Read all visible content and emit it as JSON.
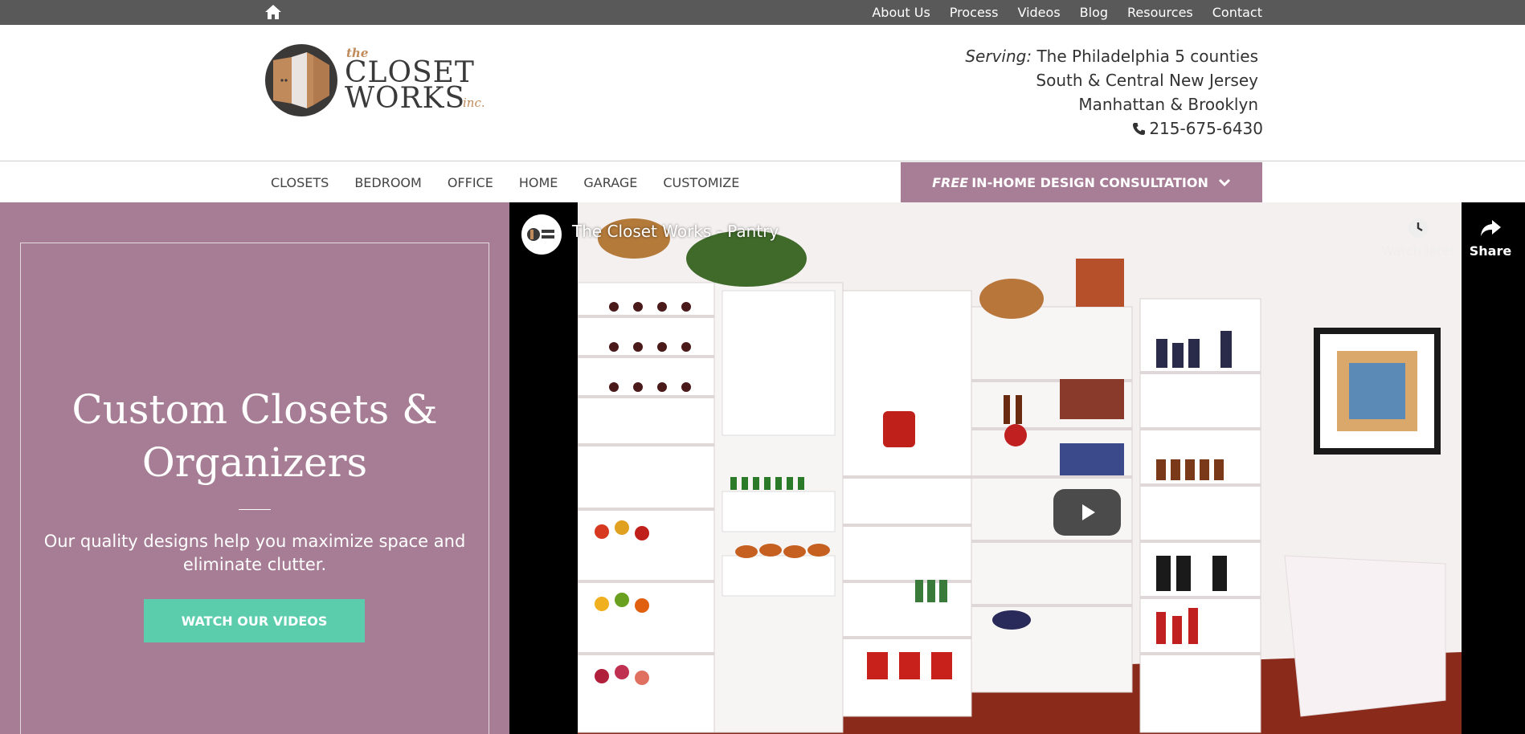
{
  "topbar": {
    "home_icon": "home-icon",
    "links": [
      "About Us",
      "Process",
      "Videos",
      "Blog",
      "Resources",
      "Contact"
    ]
  },
  "header": {
    "logo": {
      "the": "the",
      "closet": "CLOSET",
      "works": "WORKS",
      "inc": "inc."
    },
    "serving_label": "Serving:",
    "serving_line1": "The Philadelphia 5 counties",
    "serving_line2": "South & Central New Jersey",
    "serving_line3": "Manhattan & Brooklyn",
    "phone": "215-675-6430",
    "phone_icon": "phone-icon"
  },
  "nav": {
    "items": [
      "CLOSETS",
      "BEDROOM",
      "OFFICE",
      "HOME",
      "GARAGE",
      "CUSTOMIZE"
    ],
    "consult_free": "FREE",
    "consult_text": "IN-HOME DESIGN CONSULTATION",
    "consult_icon": "chevron-down-icon"
  },
  "hero": {
    "title_line1": "Custom Closets &",
    "title_line2": "Organizers",
    "subtitle_line1": "Our quality designs help you maximize space and",
    "subtitle_line2": "eliminate clutter.",
    "button": "WATCH OUR VIDEOS"
  },
  "video": {
    "title": "The Closet Works - Pantry",
    "watch_later": "Watch later",
    "share": "Share",
    "play_icon": "play-icon"
  },
  "colors": {
    "topbar": "#595959",
    "mauve": "#a67d94",
    "consult": "#a87d96",
    "teal": "#5bcdad",
    "logo_accent": "#c08a5b"
  }
}
